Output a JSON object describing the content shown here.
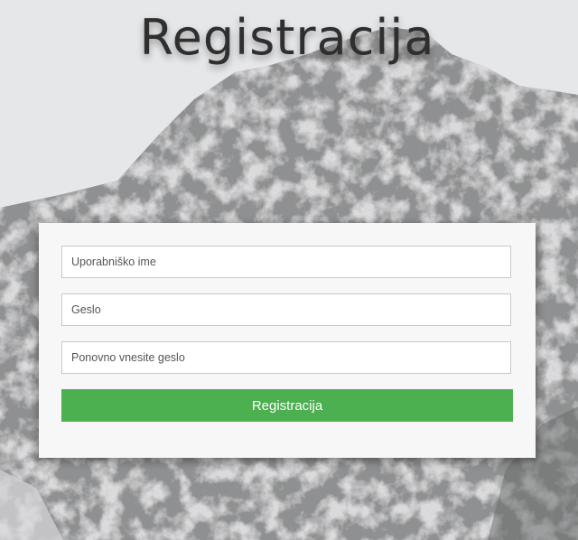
{
  "page": {
    "title": "Registracija"
  },
  "form": {
    "username_placeholder": "Uporabniško ime",
    "password_placeholder": "Geslo",
    "password_repeat_placeholder": "Ponovno vnesite geslo",
    "submit_label": "Registracija"
  },
  "colors": {
    "submit_button": "#4caf50",
    "card_background": "#f7f7f7",
    "title_text": "#2f2f2f"
  }
}
